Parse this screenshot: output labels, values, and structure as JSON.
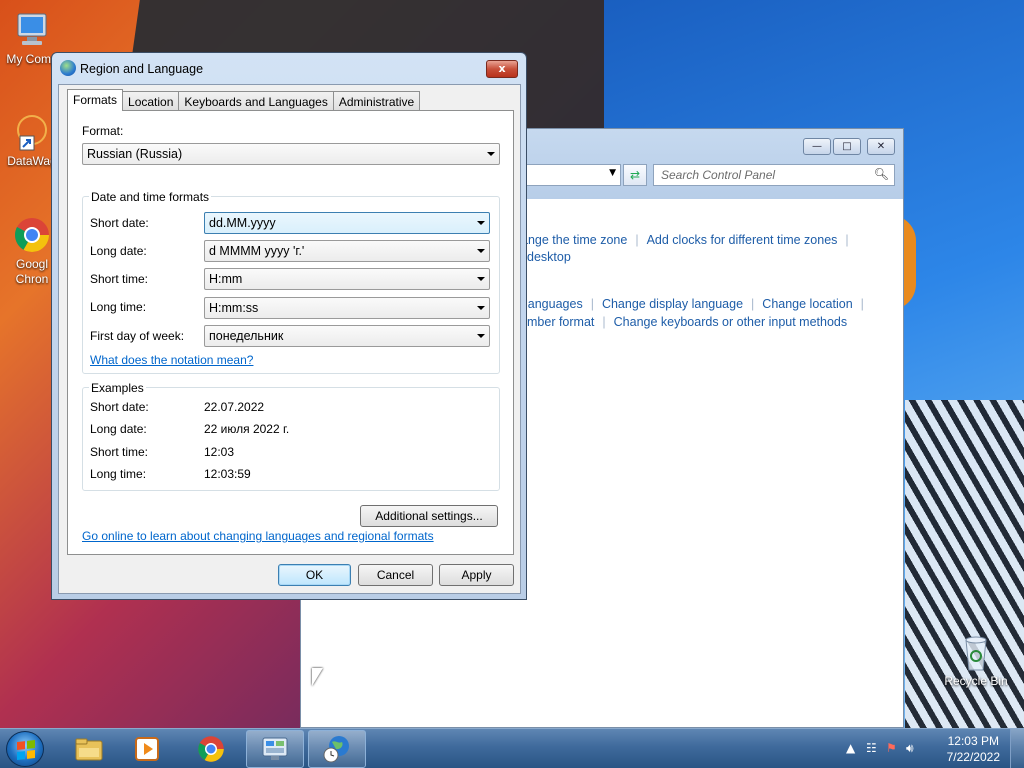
{
  "desktop": {
    "icons": [
      {
        "label": "My Comp",
        "icon": "computer-icon"
      },
      {
        "label": "DataWag",
        "icon": "shortcut-icon"
      },
      {
        "label": "Googl Chron",
        "icon": "chrome-icon"
      },
      {
        "label": "Recycle Bin",
        "icon": "recycle-bin-icon"
      }
    ]
  },
  "control_panel": {
    "search_placeholder": "Search Control Panel",
    "links_row1": [
      "ange the time zone",
      "Add clocks for different time zones"
    ],
    "links_row2": [
      "desktop"
    ],
    "links_row3": [
      "languages",
      "Change display language",
      "Change location"
    ],
    "links_row4": [
      "mber format",
      "Change keyboards or other input methods"
    ]
  },
  "dialog": {
    "title": "Region and Language",
    "close_label": "x",
    "tabs": [
      "Formats",
      "Location",
      "Keyboards and Languages",
      "Administrative"
    ],
    "format_label": "Format:",
    "format_value": "Russian (Russia)",
    "datetime_group_label": "Date and time formats",
    "fields": [
      {
        "label": "Short date:",
        "value": "dd.MM.yyyy"
      },
      {
        "label": "Long date:",
        "value": "d MMMM yyyy 'г.'"
      },
      {
        "label": "Short time:",
        "value": "H:mm"
      },
      {
        "label": "Long time:",
        "value": "H:mm:ss"
      },
      {
        "label": "First day of week:",
        "value": "понедельник"
      }
    ],
    "notation_link": "What does the notation mean?",
    "examples_label": "Examples",
    "examples": [
      {
        "label": "Short date:",
        "value": "22.07.2022"
      },
      {
        "label": "Long date:",
        "value": "22 июля 2022 г."
      },
      {
        "label": "Short time:",
        "value": "12:03"
      },
      {
        "label": "Long time:",
        "value": "12:03:59"
      }
    ],
    "additional_settings": "Additional settings...",
    "online_link": "Go online to learn about changing languages and regional formats",
    "ok": "OK",
    "cancel": "Cancel",
    "apply": "Apply"
  },
  "taskbar": {
    "time": "12:03 PM",
    "date": "7/22/2022",
    "apps": [
      "explorer-icon",
      "media-player-icon",
      "chrome-icon",
      "control-panel-icon",
      "region-language-icon"
    ]
  }
}
